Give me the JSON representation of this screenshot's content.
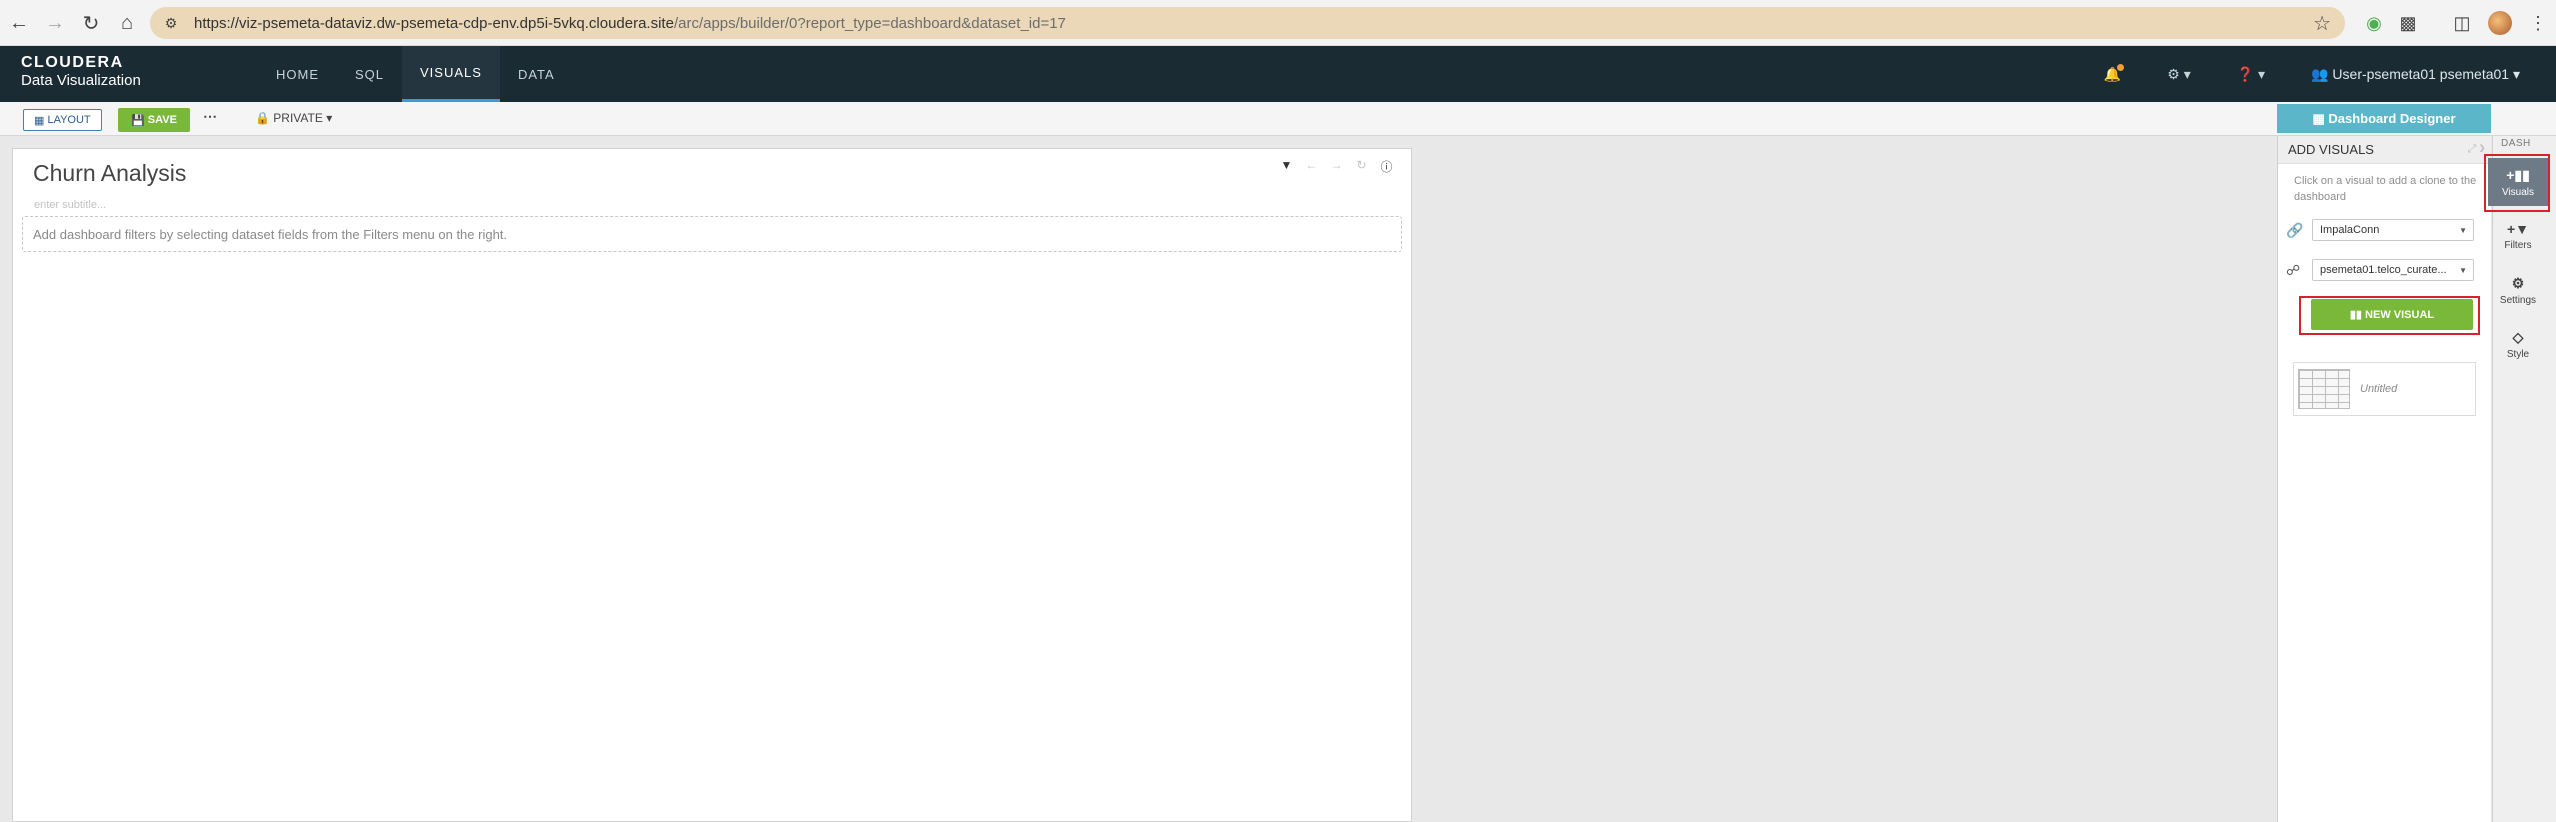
{
  "browser": {
    "url_host": "https://viz-psemeta-dataviz.dw-psemeta-cdp-env.dp5i-5vkq.cloudera.site",
    "url_path": "/arc/apps/builder/0?report_type=dashboard&dataset_id=17"
  },
  "header": {
    "brand_top": "CLOUDERA",
    "brand_bottom": "Data Visualization",
    "nav": [
      "HOME",
      "SQL",
      "VISUALS",
      "DATA"
    ],
    "active_nav": "VISUALS",
    "user": "User-psemeta01 psemeta01"
  },
  "toolbar": {
    "layout_label": "LAYOUT",
    "save_label": "SAVE",
    "more_label": "⋯",
    "private_label": "PRIVATE"
  },
  "dashboard": {
    "title": "Churn Analysis",
    "subtitle_placeholder": "enter subtitle...",
    "filters_hint": "Add dashboard filters by selecting dataset fields from the Filters menu on the right."
  },
  "designer": {
    "button_label": "Dashboard Designer",
    "panel_title": "ADD VISUALS",
    "help_text": "Click on a visual to add a clone to the dashboard",
    "connection": "ImpalaConn",
    "dataset": "psemeta01.telco_curate...",
    "new_visual_label": "NEW VISUAL",
    "visual_card_name": "Untitled"
  },
  "side_tabs": {
    "dash_label": "DASH",
    "tabs": [
      {
        "label": "Visuals",
        "icon": "add-visual-icon"
      },
      {
        "label": "Filters",
        "icon": "add-filter-icon"
      },
      {
        "label": "Settings",
        "icon": "cogs-icon"
      },
      {
        "label": "Style",
        "icon": "diamond-icon"
      }
    ]
  },
  "colors": {
    "app_header": "#1b2b34",
    "save_green": "#7ab83a",
    "designer_teal": "#5bb6c9",
    "highlight_red": "#d4232b"
  }
}
